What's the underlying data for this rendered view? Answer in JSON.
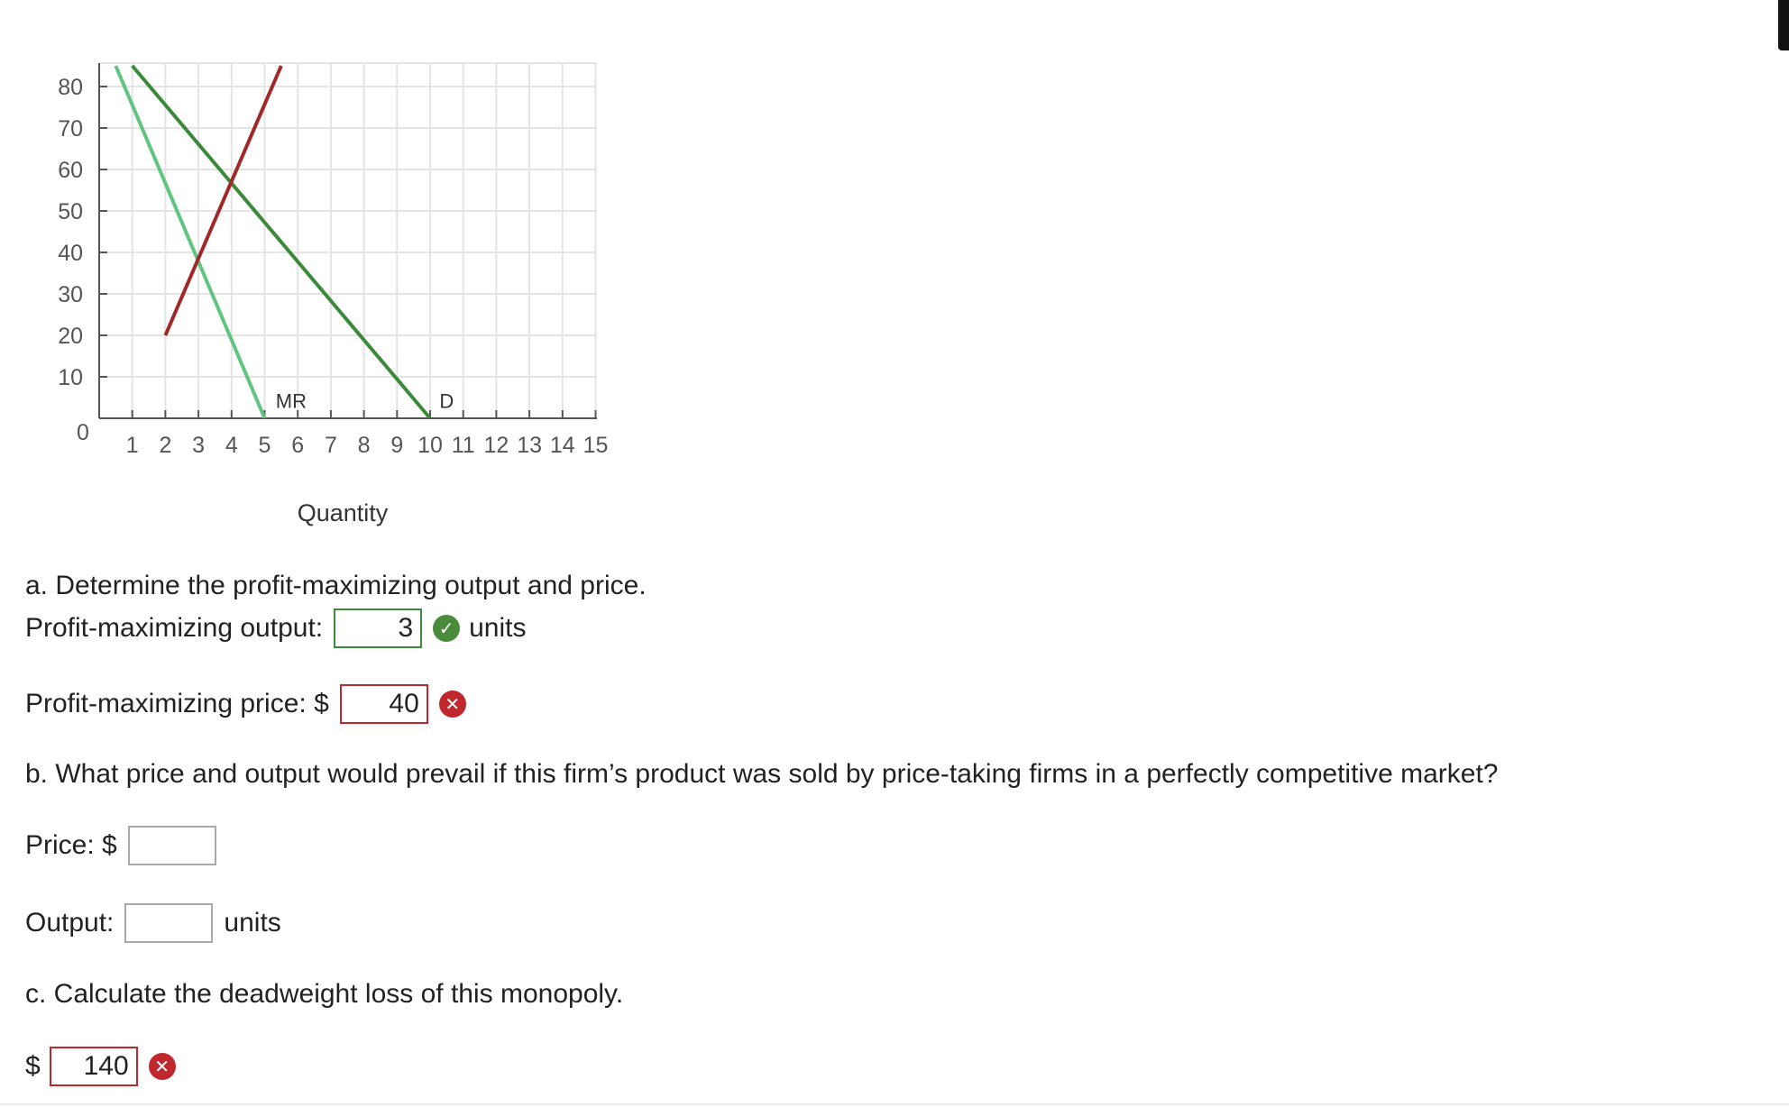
{
  "chart_data": {
    "type": "line",
    "xlabel": "Quantity",
    "ylabel": "",
    "xlim": [
      0,
      15
    ],
    "ylim": [
      0,
      85
    ],
    "x_ticks": [
      1,
      2,
      3,
      4,
      5,
      6,
      7,
      8,
      9,
      10,
      11,
      12,
      13,
      14,
      15
    ],
    "y_ticks": [
      10,
      20,
      30,
      40,
      50,
      60,
      70,
      80
    ],
    "origin_label": "0",
    "grid": true,
    "series": [
      {
        "name": "MR",
        "color": "#5fc57f",
        "points": [
          [
            0.5,
            85
          ],
          [
            5,
            0
          ]
        ]
      },
      {
        "name": "D",
        "color": "#3a8a3a",
        "points": [
          [
            1,
            85
          ],
          [
            10,
            0
          ]
        ]
      },
      {
        "name": "",
        "color": "#a02828",
        "points": [
          [
            2,
            20
          ],
          [
            5.5,
            85
          ]
        ]
      }
    ],
    "annotations": [
      {
        "text": "MR",
        "x": 5.8,
        "y": 2.5
      },
      {
        "text": "D",
        "x": 10.5,
        "y": 2.5
      }
    ]
  },
  "questions": {
    "a": {
      "prompt": "a. Determine the profit-maximizing output and price.",
      "output_label": "Profit-maximizing output:",
      "output_value": "3",
      "output_unit": "units",
      "output_status": "correct",
      "price_label": "Profit-maximizing price: $",
      "price_value": "40",
      "price_status": "incorrect"
    },
    "b": {
      "prompt": "b. What price and output would prevail if this firm’s product was sold by price-taking firms in a perfectly competitive market?",
      "price_label": "Price: $",
      "price_value": "",
      "output_label": "Output:",
      "output_value": "",
      "output_unit": "units"
    },
    "c": {
      "prompt": "c. Calculate the deadweight loss of this monopoly.",
      "label": "$",
      "value": "140",
      "status": "incorrect"
    }
  },
  "icons": {
    "correct": "check-circle-icon",
    "incorrect": "x-circle-icon"
  },
  "colors": {
    "correct": "#4a8b3c",
    "incorrect": "#c0282d"
  }
}
